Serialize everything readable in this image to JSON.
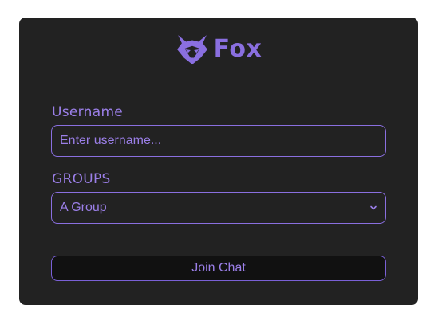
{
  "brand": {
    "name": "Fox",
    "logo_icon": "fox-head-icon",
    "color": "#8a6fe0"
  },
  "form": {
    "username_label": "Username",
    "username_placeholder": "Enter username...",
    "username_value": "",
    "groups_label": "GROUPS",
    "group_selected": "A Group",
    "join_label": "Join Chat"
  },
  "colors": {
    "card_background": "#222222",
    "accent": "#8a6fe0",
    "button_background": "#111111"
  }
}
